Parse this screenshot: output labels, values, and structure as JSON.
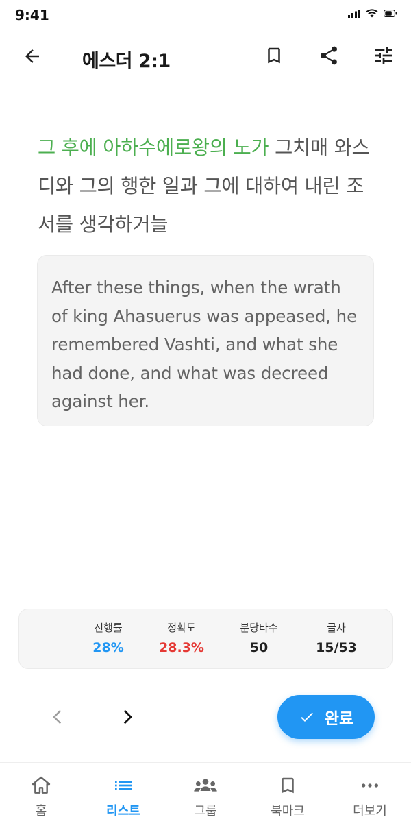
{
  "status_bar": {
    "time": "9:41"
  },
  "app_bar": {
    "title": "에스더 2:1"
  },
  "verse": {
    "typed": "그 후에 아하수에로왕의 노가",
    "remaining": " 그치매 와스디와 그의 행한 일과 그에 대하여 내린 조서를 생각하거늘"
  },
  "english": {
    "text": "After these things, when the wrath of king Ahasuerus was appeased, he remembered Vashti, and what she had done, and what was decreed against her."
  },
  "stats": {
    "progress_label": "진행률",
    "progress_value": "28%",
    "accuracy_label": "정확도",
    "accuracy_value": "28.3%",
    "speed_label": "분당타수",
    "speed_value": "50",
    "chars_label": "글자",
    "chars_value": "15/53"
  },
  "colors": {
    "accent": "#2196f3",
    "typed": "#4caf50",
    "accuracy": "#e53935"
  },
  "actions": {
    "done_label": "완료"
  },
  "bottom_nav": {
    "home": "홈",
    "list": "리스트",
    "group": "그룹",
    "bookmark": "북마크",
    "more": "더보기",
    "active": "list"
  }
}
